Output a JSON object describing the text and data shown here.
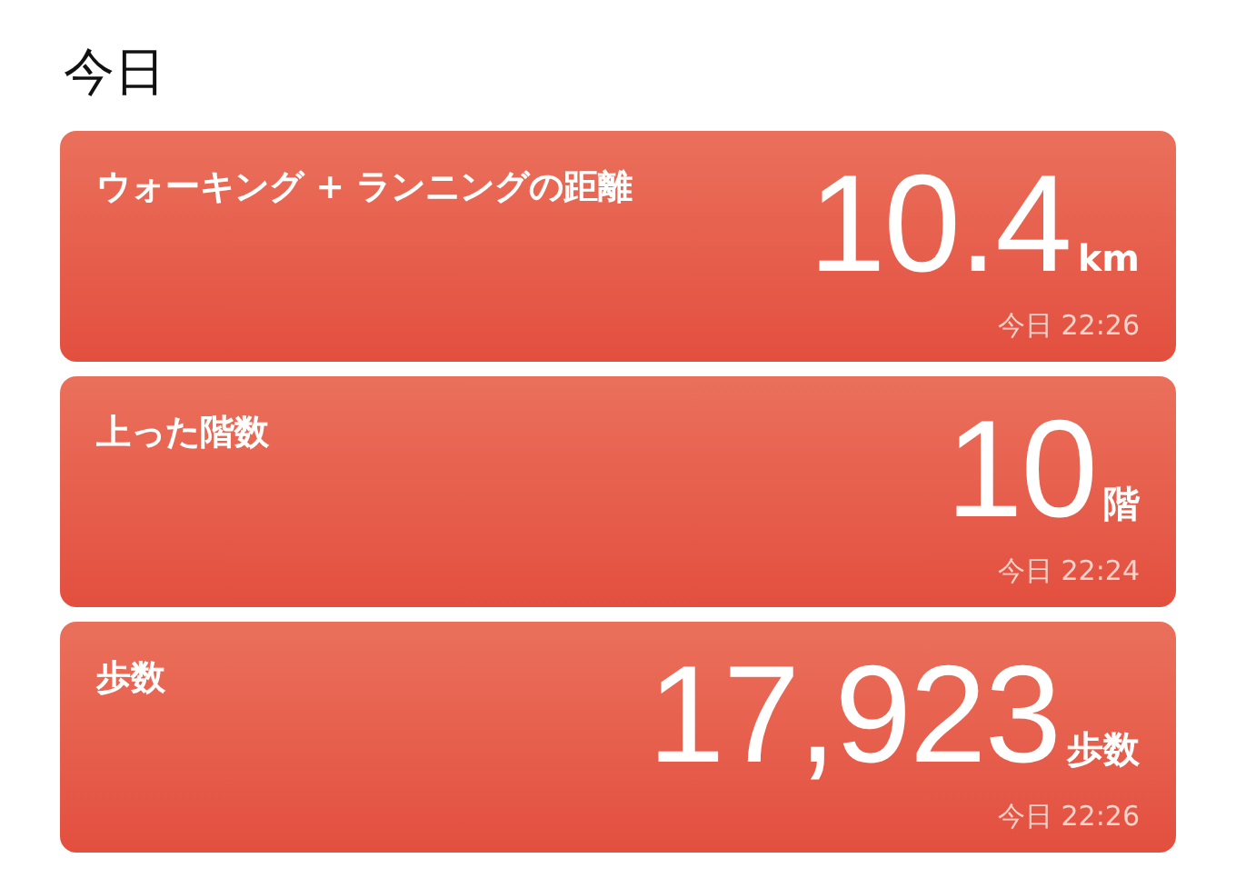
{
  "title": "今日",
  "cards": [
    {
      "label": "ウォーキング + ランニングの距離",
      "value": "10.4",
      "unit": "km",
      "time": "今日 22:26"
    },
    {
      "label": "上った階数",
      "value": "10",
      "unit": "階",
      "time": "今日 22:24"
    },
    {
      "label": "歩数",
      "value": "17,923",
      "unit": "歩数",
      "time": "今日 22:26"
    }
  ]
}
